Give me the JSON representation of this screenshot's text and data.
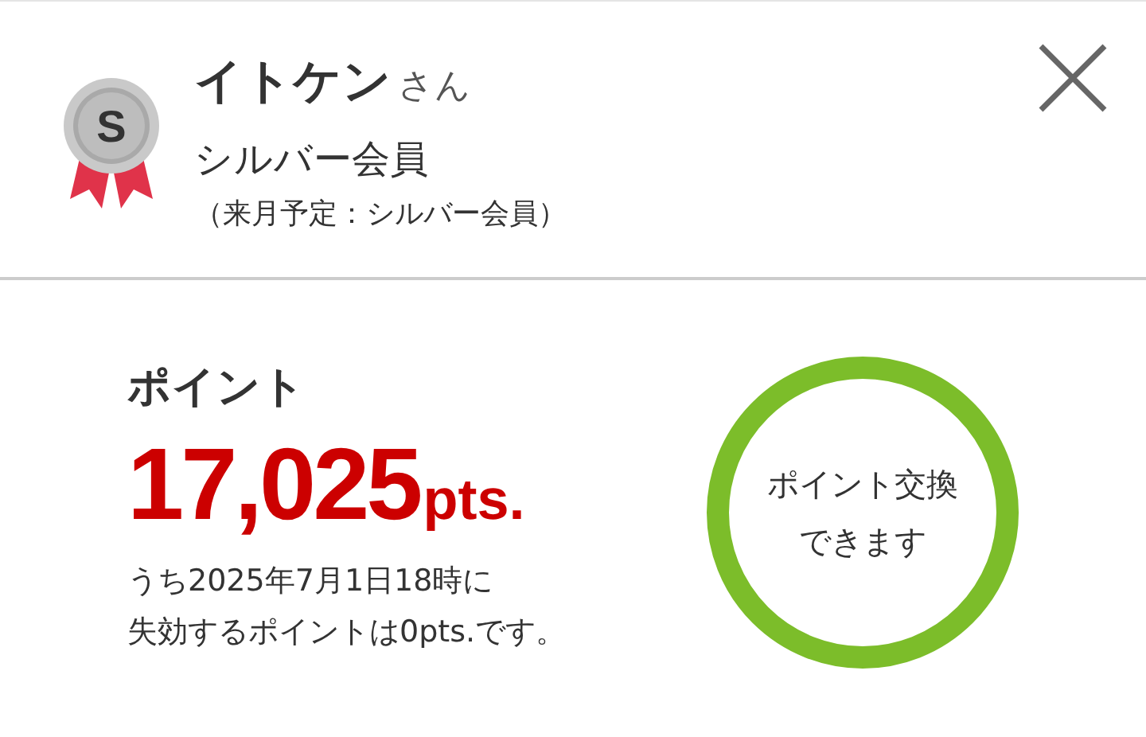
{
  "member": {
    "badge_letter": "S",
    "name": "イトケン",
    "honorific": "さん",
    "rank": "シルバー会員",
    "next_month": "（来月予定：シルバー会員）"
  },
  "points": {
    "label": "ポイント",
    "value": "17,025",
    "unit": "pts.",
    "expiry_lines": [
      "うち2025年7月1日18時に",
      "失効するポイントは0pts.です。"
    ]
  },
  "exchange_button": {
    "lines": [
      "ポイント交換",
      "できます"
    ]
  }
}
